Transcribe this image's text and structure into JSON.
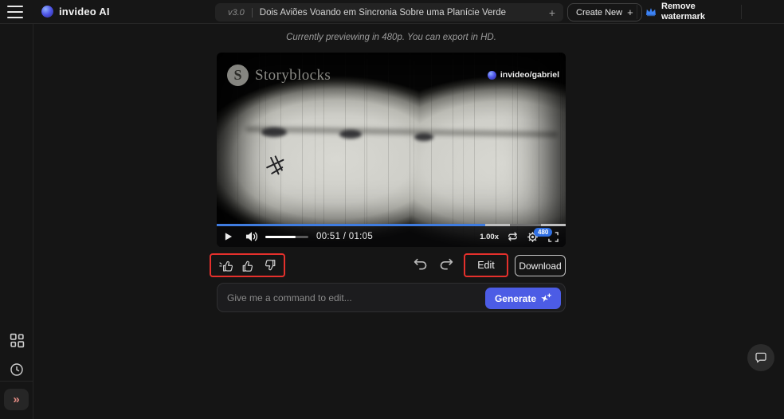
{
  "colors": {
    "accent-blue": "#3b82f6",
    "generate-blue": "#4c5ce5",
    "highlight-red": "#e5302c",
    "progress-blue": "#3f7ce0",
    "collapse-red": "#e08a82"
  },
  "header": {
    "app_name": "invideo AI",
    "version_label": "v3.0",
    "project_title": "Dois Aviões Voando em Sincronia Sobre uma Planície Verde",
    "new_chat_plus": "+",
    "create_new_label": "Create New",
    "create_new_plus": "+",
    "remove_watermark_label": "Remove watermark"
  },
  "preview_note": "Currently previewing in 480p. You can export in HD.",
  "player": {
    "brand_logo_letter": "S",
    "brand_watermark": "Storyblocks",
    "user_watermark": "invideo/gabriel",
    "time_display": "00:51 / 01:05",
    "playback_speed": "1.00x",
    "quality_badge": "480",
    "progress_percent": 77,
    "volume_percent": 70
  },
  "actions": {
    "edit_label": "Edit",
    "download_label": "Download"
  },
  "command_bar": {
    "placeholder": "Give me a command to edit...",
    "generate_label": "Generate"
  },
  "sidebar": {
    "expand_glyph": "»"
  }
}
